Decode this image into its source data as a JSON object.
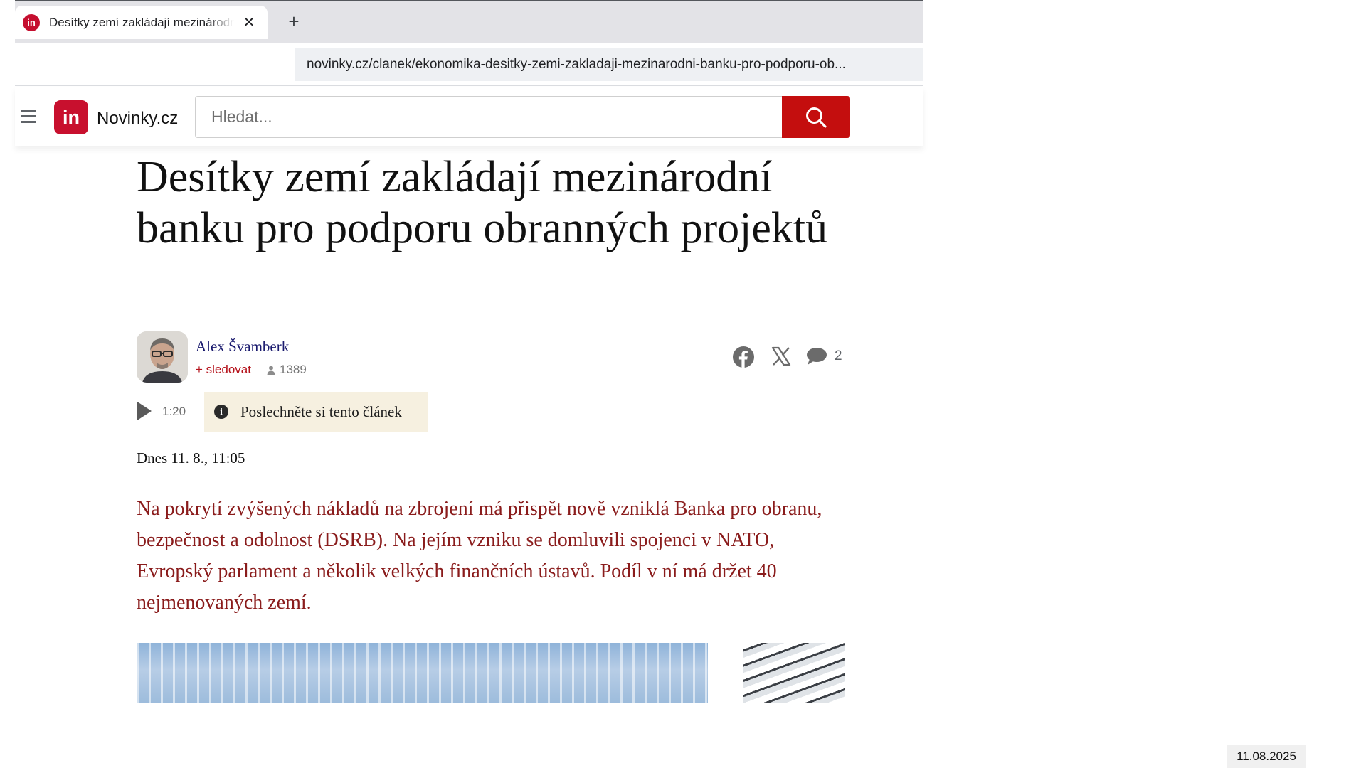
{
  "browser": {
    "tab_title": "Desítky zemí zakládají mezinárodní banku pro podporu obranných projektů",
    "tab_favicon": "in",
    "close_glyph": "✕",
    "new_tab_glyph": "+",
    "url": "novinky.cz/clanek/ekonomika-desitky-zemi-zakladaji-mezinarodni-banku-pro-podporu-ob..."
  },
  "site": {
    "logo_badge": "in",
    "logo_text": "Novinky.cz",
    "search_placeholder": "Hledat...",
    "brand_color": "#c8102e"
  },
  "article": {
    "headline": "Desítky zemí zakládají mezinárodní banku pro podporu obranných projektů",
    "author": {
      "name": "Alex Švamberk",
      "follow_label": "+ sledovat",
      "followers": "1389"
    },
    "share": {
      "facebook_icon": "facebook-icon",
      "x_icon": "x-icon",
      "comments_icon": "comment-icon",
      "comments_count": "2"
    },
    "audio": {
      "duration": "1:20",
      "info_glyph": "i",
      "listen_label": "Poslechněte si tento článek"
    },
    "date": "Dnes 11. 8., 11:05",
    "perex": "Na pokrytí zvýšených nákladů na zbrojení má přispět nově vzniklá Banka pro obranu, bezpečnost a odolnost (DSRB). Na jejím vzniku se domluvili spojenci v NATO, Evropský parlament a několik velkých finančních ústavů. Podíl v ní má držet 40 nejmenovaných zemí.",
    "perex_color": "#8a1c1c"
  },
  "taskbar": {
    "date": "11.08.2025"
  }
}
